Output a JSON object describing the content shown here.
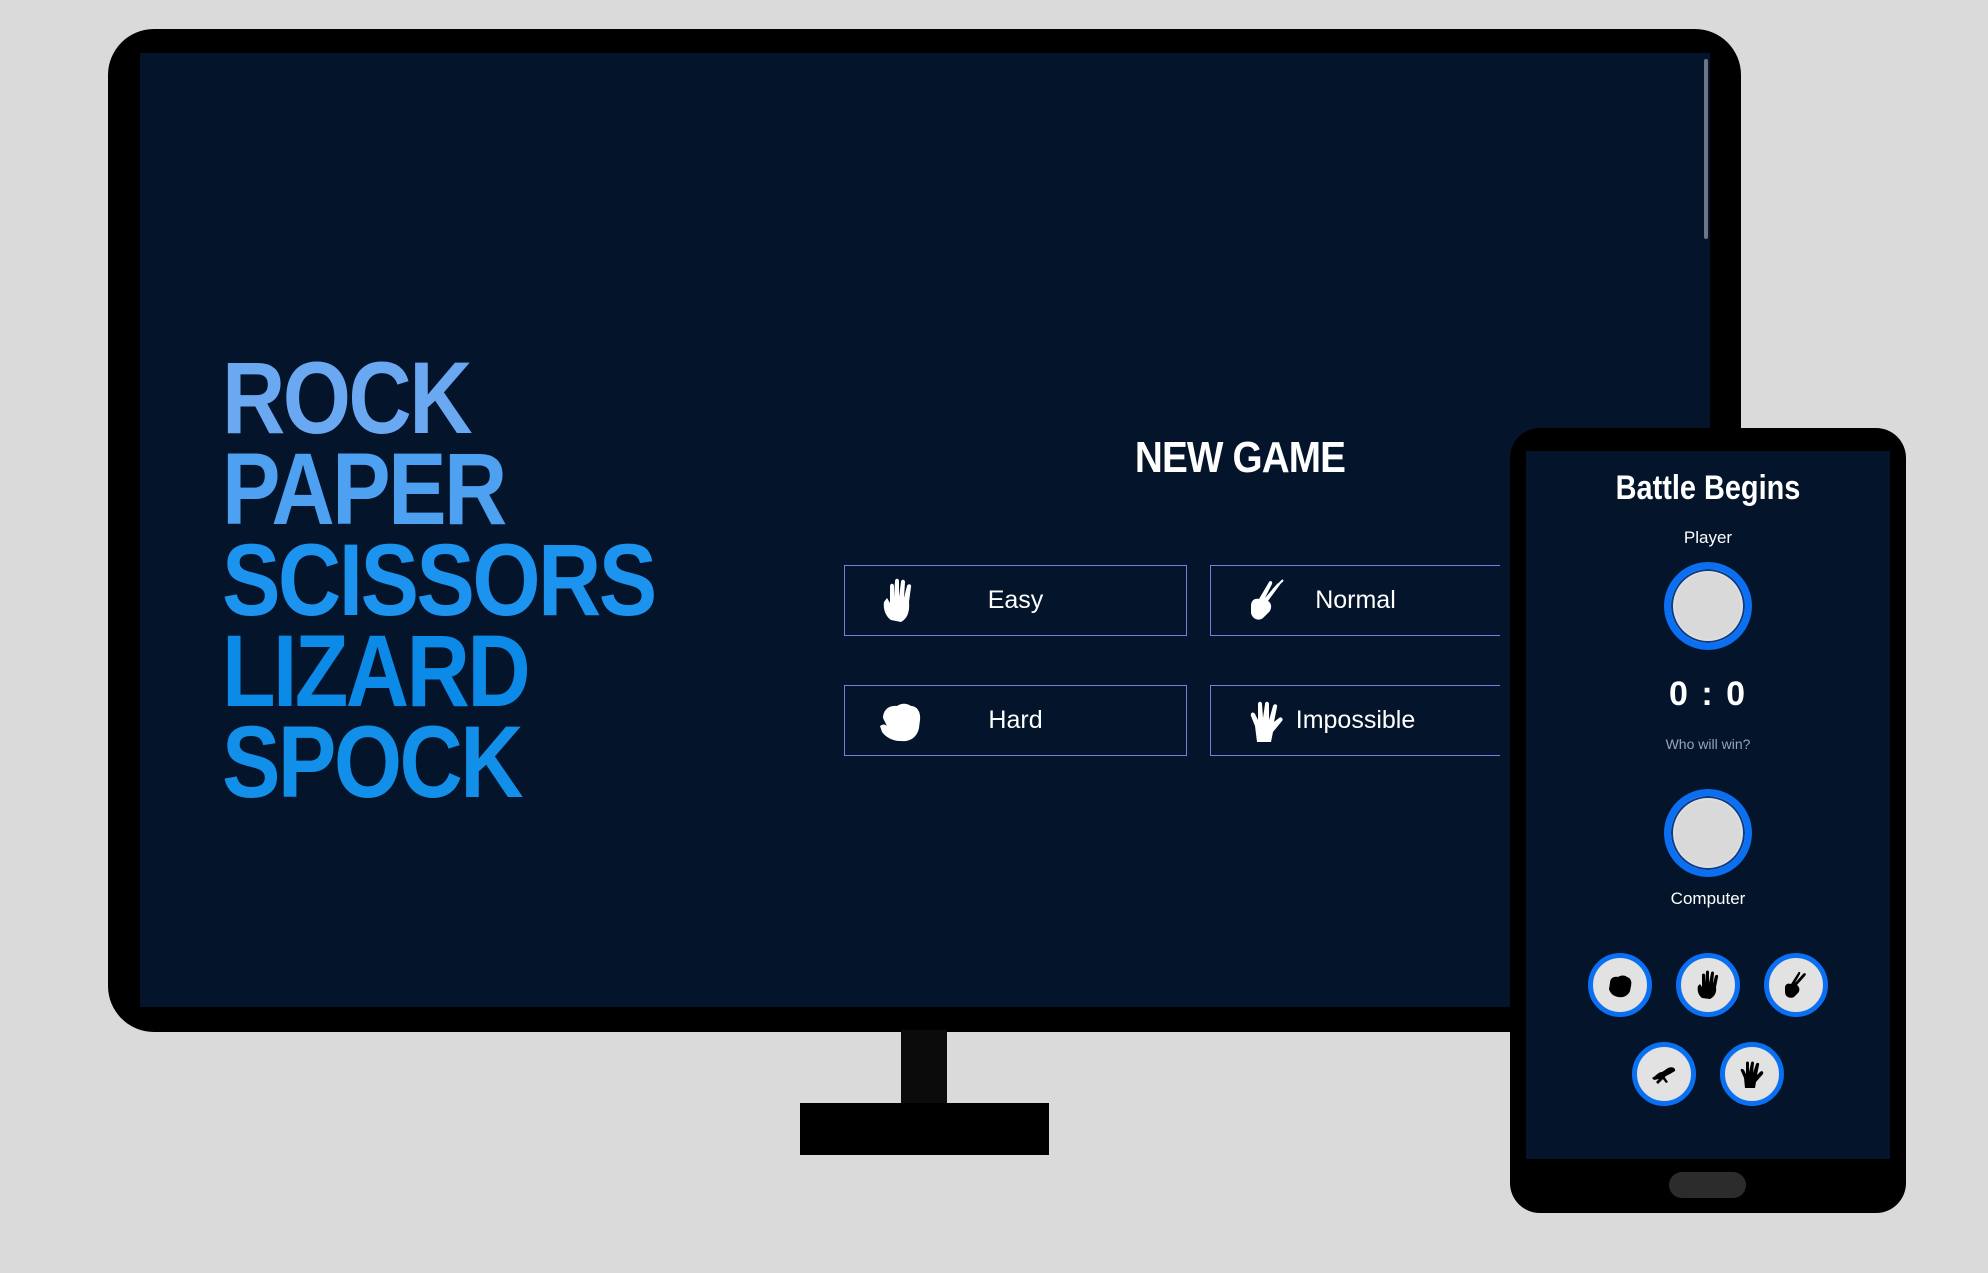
{
  "desktop": {
    "title_lines": [
      "ROCK",
      "PAPER",
      "SCISSORS",
      "LIZARD",
      "SPOCK"
    ],
    "new_game_label": "NEW GAME",
    "modes": [
      {
        "label": "Easy",
        "icon": "paper-hand-icon"
      },
      {
        "label": "Normal",
        "icon": "scissors-hand-icon"
      },
      {
        "label": "Hard",
        "icon": "rock-fist-icon"
      },
      {
        "label": "Impossible",
        "icon": "spock-hand-icon"
      }
    ]
  },
  "mobile": {
    "title": "Battle Begins",
    "player_label": "Player",
    "score": "0 : 0",
    "prompt": "Who will win?",
    "computer_label": "Computer",
    "choices": [
      "rock-icon",
      "paper-icon",
      "scissors-icon",
      "lizard-icon",
      "spock-icon"
    ]
  },
  "colors": {
    "screen_bg": "#03142b",
    "accent_blue": "#0a6ff0",
    "button_border": "#7a7de0"
  }
}
